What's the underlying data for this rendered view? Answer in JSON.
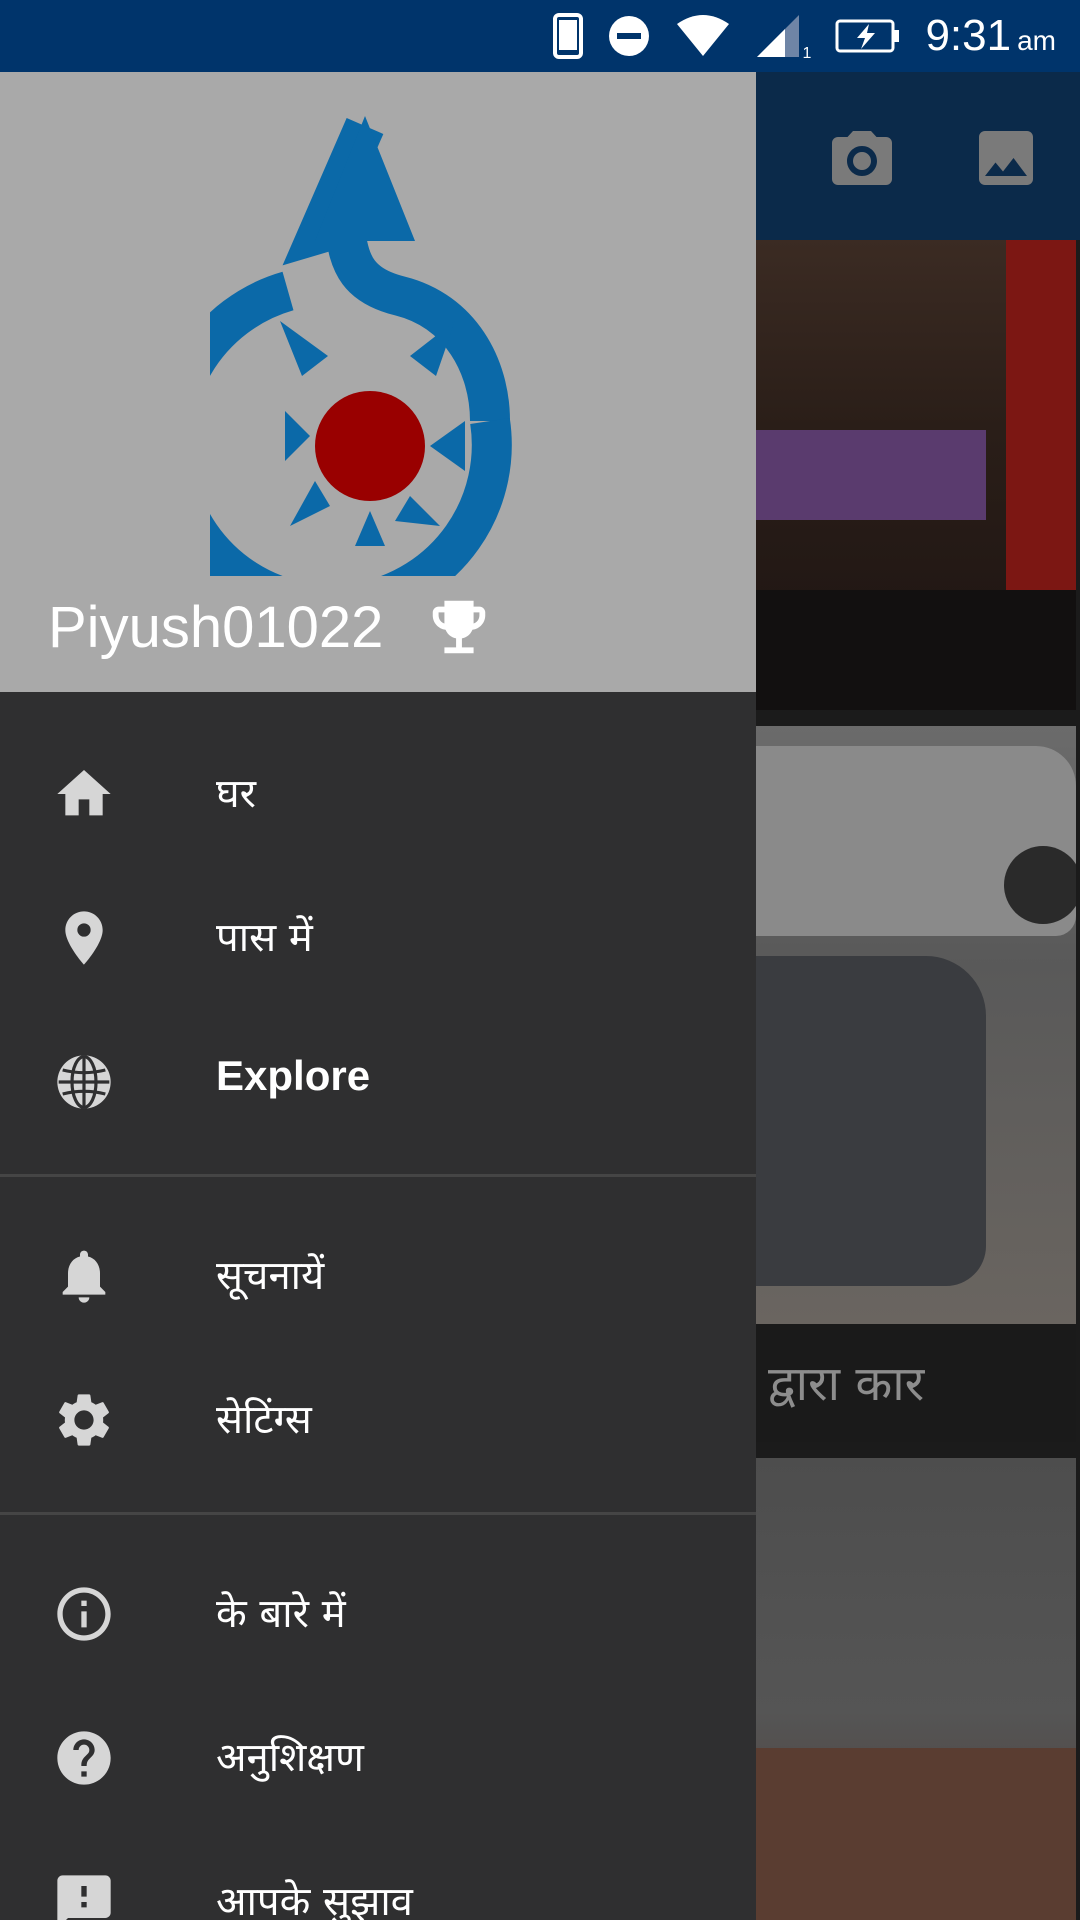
{
  "status_bar": {
    "time": "9:31",
    "am_pm": "am",
    "sim_label": "1",
    "icons": [
      "phone-icon",
      "do-not-disturb-icon",
      "wifi-icon",
      "signal-icon",
      "battery-charging-icon"
    ]
  },
  "toolbar": {
    "icons": [
      "camera-icon",
      "gallery-icon"
    ]
  },
  "background": {
    "caption": "द्वारा कार"
  },
  "drawer": {
    "username": "Piyush01022",
    "logo": "wikimedia-commons-logo",
    "menu": [
      {
        "label": "घर",
        "icon": "home-icon"
      },
      {
        "label": "पास में",
        "icon": "location-pin-icon"
      },
      {
        "label": "Explore",
        "icon": "globe-icon"
      },
      {
        "label": "सूचनायें",
        "icon": "bell-icon"
      },
      {
        "label": "सेटिंग्स",
        "icon": "gear-icon"
      },
      {
        "label": "के बारे में",
        "icon": "info-icon"
      },
      {
        "label": "अनुशिक्षण",
        "icon": "help-icon"
      },
      {
        "label": "आपके सुझाव",
        "icon": "feedback-icon"
      }
    ]
  },
  "colors": {
    "status_bar": "#00346b",
    "drawer_bg": "#2f2f30",
    "header_bg": "#a9a9a9",
    "logo_blue": "#0b69a8",
    "logo_red": "#990000"
  }
}
